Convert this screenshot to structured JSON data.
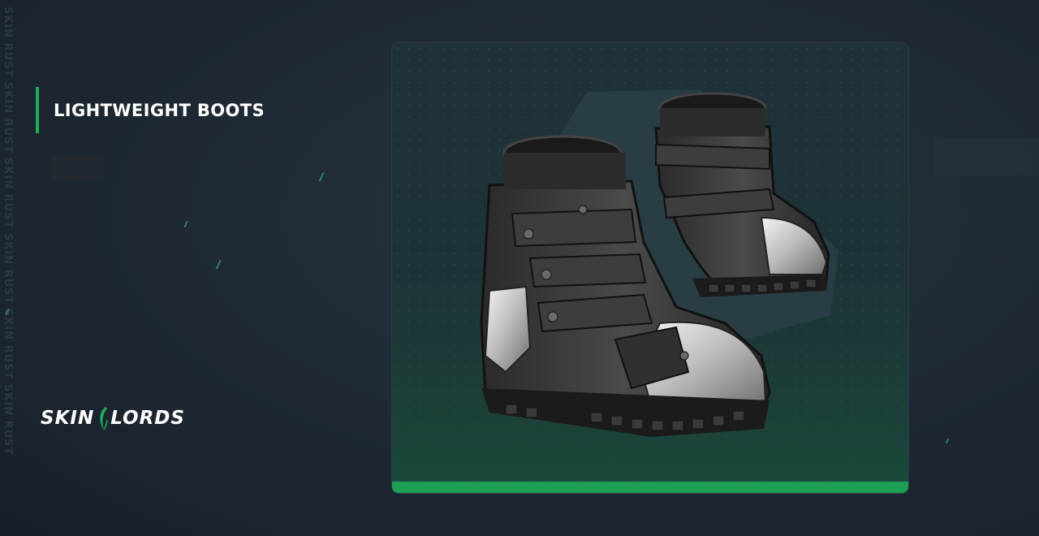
{
  "side_watermark": "SKIN RUST SKIN RUST SKIN RUST SKIN RUST SKIN RUST SKIN RUST",
  "item": {
    "title": "LIGHTWEIGHT BOOTS"
  },
  "brand": {
    "left": "SKIN",
    "right": "LORDS"
  },
  "colors": {
    "accent": "#1fae5c",
    "background": "#1d2833",
    "card_bottom_bar": "#1c9e54"
  },
  "icons": {
    "logo_mark": "crescent-blade-icon",
    "item_image": "boots-icon"
  }
}
